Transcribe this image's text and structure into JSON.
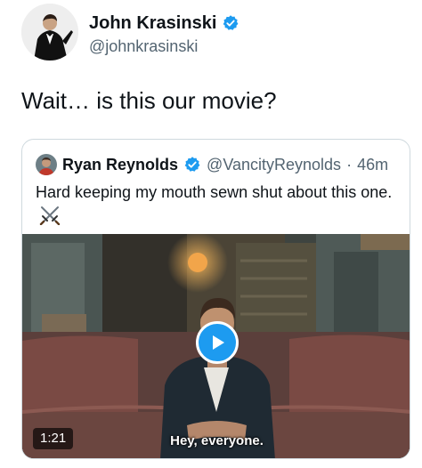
{
  "author": {
    "name": "John Krasinski",
    "handle": "@johnkrasinski",
    "verified": true,
    "badge_color": "#1d9bf0"
  },
  "tweet": {
    "text": "Wait… is this our movie?"
  },
  "quoted_tweet": {
    "name": "Ryan Reynolds",
    "handle": "@VancityReynolds",
    "separator": "·",
    "time": "46m",
    "verified": true,
    "text": "Hard keeping my mouth sewn shut about this one.",
    "emoji_icon": "crossed-swords-icon"
  },
  "video": {
    "duration": "1:21",
    "subtitle": "Hey, everyone.",
    "play_button_color": "#1d9bf0"
  }
}
